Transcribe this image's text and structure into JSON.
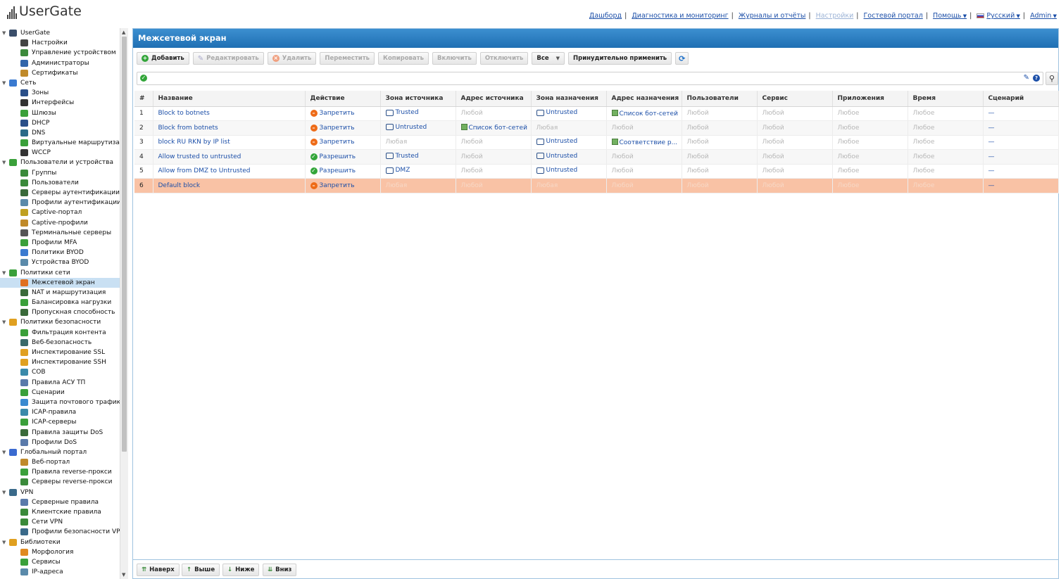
{
  "app": {
    "logo_text": "UserGate",
    "colors": {
      "accent": "#1f6fb3",
      "deny": "#ee6b17",
      "allow": "#32a539",
      "highlight": "#f9c2a5",
      "link": "#1c4fa8"
    }
  },
  "topnav": {
    "dashboard": "Дашборд",
    "diagnostics": "Диагностика и мониторинг",
    "logs": "Журналы и отчёты",
    "settings": "Настройки",
    "guest_portal": "Гостевой портал",
    "help": "Помощь",
    "language": "Русский",
    "user": "Admin"
  },
  "sidebar": {
    "items": [
      {
        "level": 0,
        "label": "UserGate",
        "icon": "gear-icon",
        "color": "#3a4e6a"
      },
      {
        "level": 1,
        "label": "Настройки",
        "icon": "settings-icon",
        "color": "#444"
      },
      {
        "level": 1,
        "label": "Управление устройством",
        "icon": "device-icon",
        "color": "#3c8a3c"
      },
      {
        "level": 1,
        "label": "Администраторы",
        "icon": "admins-icon",
        "color": "#3366aa"
      },
      {
        "level": 1,
        "label": "Сертификаты",
        "icon": "certificate-icon",
        "color": "#c08a2a"
      },
      {
        "level": 0,
        "label": "Сеть",
        "icon": "network-icon",
        "color": "#3a7ad0"
      },
      {
        "level": 1,
        "label": "Зоны",
        "icon": "zones-icon",
        "color": "#2a4f88"
      },
      {
        "level": 1,
        "label": "Интерфейсы",
        "icon": "interfaces-icon",
        "color": "#333"
      },
      {
        "level": 1,
        "label": "Шлюзы",
        "icon": "gateways-icon",
        "color": "#3aa03a"
      },
      {
        "level": 1,
        "label": "DHCP",
        "icon": "dhcp-icon",
        "color": "#2a4f88"
      },
      {
        "level": 1,
        "label": "DNS",
        "icon": "dns-icon",
        "color": "#2a6a88"
      },
      {
        "level": 1,
        "label": "Виртуальные маршрутизаторы",
        "icon": "router-icon",
        "color": "#3aa03a"
      },
      {
        "level": 1,
        "label": "WCCP",
        "icon": "wccp-icon",
        "color": "#333"
      },
      {
        "level": 0,
        "label": "Пользователи и устройства",
        "icon": "users-devices-icon",
        "color": "#3aa03a"
      },
      {
        "level": 1,
        "label": "Группы",
        "icon": "groups-icon",
        "color": "#3a8a3a"
      },
      {
        "level": 1,
        "label": "Пользователи",
        "icon": "users-icon",
        "color": "#3a8a3a"
      },
      {
        "level": 1,
        "label": "Серверы аутентификации",
        "icon": "auth-server-icon",
        "color": "#3a6a3a"
      },
      {
        "level": 1,
        "label": "Профили аутентификации",
        "icon": "auth-profile-icon",
        "color": "#5a8aaa"
      },
      {
        "level": 1,
        "label": "Captive-портал",
        "icon": "captive-portal-icon",
        "color": "#c0a020"
      },
      {
        "level": 1,
        "label": "Captive-профили",
        "icon": "captive-profile-icon",
        "color": "#c08a2a"
      },
      {
        "level": 1,
        "label": "Терминальные серверы",
        "icon": "terminal-server-icon",
        "color": "#555"
      },
      {
        "level": 1,
        "label": "Профили MFA",
        "icon": "mfa-icon",
        "color": "#3aa03a"
      },
      {
        "level": 1,
        "label": "Политики BYOD",
        "icon": "byod-policy-icon",
        "color": "#3a7ad0"
      },
      {
        "level": 1,
        "label": "Устройства BYOD",
        "icon": "byod-device-icon",
        "color": "#5a8aaa"
      },
      {
        "level": 0,
        "label": "Политики сети",
        "icon": "network-policy-icon",
        "color": "#3aa03a"
      },
      {
        "level": 1,
        "label": "Межсетевой экран",
        "icon": "firewall-icon",
        "color": "#e07020",
        "selected": true
      },
      {
        "level": 1,
        "label": "NAT и маршрутизация",
        "icon": "nat-icon",
        "color": "#3a6a3a"
      },
      {
        "level": 1,
        "label": "Балансировка нагрузки",
        "icon": "balancing-icon",
        "color": "#3aa03a"
      },
      {
        "level": 1,
        "label": "Пропускная способность",
        "icon": "bandwidth-icon",
        "color": "#3a6a3a"
      },
      {
        "level": 0,
        "label": "Политики безопасности",
        "icon": "security-policy-icon",
        "color": "#e0a020"
      },
      {
        "level": 1,
        "label": "Фильтрация контента",
        "icon": "content-filter-icon",
        "color": "#3aa03a"
      },
      {
        "level": 1,
        "label": "Веб-безопасность",
        "icon": "web-security-icon",
        "color": "#3a6a6a"
      },
      {
        "level": 1,
        "label": "Инспектирование SSL",
        "icon": "ssl-icon",
        "color": "#e0a020"
      },
      {
        "level": 1,
        "label": "Инспектирование SSH",
        "icon": "ssh-icon",
        "color": "#e0a020"
      },
      {
        "level": 1,
        "label": "СОВ",
        "icon": "ids-icon",
        "color": "#3a8aaa"
      },
      {
        "level": 1,
        "label": "Правила АСУ ТП",
        "icon": "scada-icon",
        "color": "#5a7aaa"
      },
      {
        "level": 1,
        "label": "Сценарии",
        "icon": "scenarios-icon",
        "color": "#3aa03a"
      },
      {
        "level": 1,
        "label": "Защита почтового трафика",
        "icon": "mail-security-icon",
        "color": "#3a8ad0"
      },
      {
        "level": 1,
        "label": "ICAP-правила",
        "icon": "icap-rules-icon",
        "color": "#3a8aaa"
      },
      {
        "level": 1,
        "label": "ICAP-серверы",
        "icon": "icap-servers-icon",
        "color": "#3aa03a"
      },
      {
        "level": 1,
        "label": "Правила защиты DoS",
        "icon": "dos-rules-icon",
        "color": "#3a6a3a"
      },
      {
        "level": 1,
        "label": "Профили DoS",
        "icon": "dos-profile-icon",
        "color": "#5a7aaa"
      },
      {
        "level": 0,
        "label": "Глобальный портал",
        "icon": "global-portal-icon",
        "color": "#3a6ad0"
      },
      {
        "level": 1,
        "label": "Веб-портал",
        "icon": "web-portal-icon",
        "color": "#c08a2a"
      },
      {
        "level": 1,
        "label": "Правила reverse-прокси",
        "icon": "reverse-proxy-rules-icon",
        "color": "#3aa03a"
      },
      {
        "level": 1,
        "label": "Серверы reverse-прокси",
        "icon": "reverse-proxy-servers-icon",
        "color": "#3a8a3a"
      },
      {
        "level": 0,
        "label": "VPN",
        "icon": "vpn-icon",
        "color": "#3a6a8a"
      },
      {
        "level": 1,
        "label": "Серверные правила",
        "icon": "vpn-server-rules-icon",
        "color": "#5a7aaa"
      },
      {
        "level": 1,
        "label": "Клиентские правила",
        "icon": "vpn-client-rules-icon",
        "color": "#3a8a3a"
      },
      {
        "level": 1,
        "label": "Сети VPN",
        "icon": "vpn-networks-icon",
        "color": "#3a8a3a"
      },
      {
        "level": 1,
        "label": "Профили безопасности VPN",
        "icon": "vpn-security-profile-icon",
        "color": "#3a6a8a"
      },
      {
        "level": 0,
        "label": "Библиотеки",
        "icon": "libraries-icon",
        "color": "#e0a020"
      },
      {
        "level": 1,
        "label": "Морфология",
        "icon": "morphology-icon",
        "color": "#e08a20"
      },
      {
        "level": 1,
        "label": "Сервисы",
        "icon": "services-icon",
        "color": "#3aa03a"
      },
      {
        "level": 1,
        "label": "IP-адреса",
        "icon": "ip-addresses-icon",
        "color": "#5a8aaa"
      }
    ]
  },
  "panel": {
    "title": "Межсетевой экран",
    "toolbar": {
      "add": "Добавить",
      "edit": "Редактировать",
      "delete": "Удалить",
      "move": "Переместить",
      "copy": "Копировать",
      "enable": "Включить",
      "disable": "Отключить",
      "filter": "Все",
      "force_apply": "Принудительно применить"
    },
    "search": {
      "value": "",
      "placeholder": ""
    },
    "columns": [
      "#",
      "Название",
      "Действие",
      "Зона источника",
      "Адрес источника",
      "Зона назначения",
      "Адрес назначения",
      "Пользователи",
      "Сервис",
      "Приложения",
      "Время",
      "Сценарий"
    ],
    "rows": [
      {
        "num": "1",
        "name": "Block to botnets",
        "action": "Запретить",
        "action_type": "deny",
        "src_zone": "Trusted",
        "src_addr": "Любой",
        "dst_zone": "Untrusted",
        "dst_addr": "Список бот-сетей",
        "users": "Любой",
        "service": "Любой",
        "apps": "Любое",
        "time": "Любое",
        "scenario": "—"
      },
      {
        "num": "2",
        "name": "Block from botnets",
        "action": "Запретить",
        "action_type": "deny",
        "src_zone": "Untrusted",
        "src_addr": "Список бот-сетей",
        "dst_zone": "Любая",
        "dst_addr": "Любой",
        "users": "Любой",
        "service": "Любой",
        "apps": "Любое",
        "time": "Любое",
        "scenario": "—"
      },
      {
        "num": "3",
        "name": "block RU RKN by IP list",
        "action": "Запретить",
        "action_type": "deny",
        "src_zone": "Любая",
        "src_addr": "Любой",
        "dst_zone": "Untrusted",
        "dst_addr": "Соответствие р...",
        "users": "Любой",
        "service": "Любой",
        "apps": "Любое",
        "time": "Любое",
        "scenario": "—"
      },
      {
        "num": "4",
        "name": "Allow trusted to untrusted",
        "action": "Разрешить",
        "action_type": "allow",
        "src_zone": "Trusted",
        "src_addr": "Любой",
        "dst_zone": "Untrusted",
        "dst_addr": "Любой",
        "users": "Любой",
        "service": "Любой",
        "apps": "Любое",
        "time": "Любое",
        "scenario": "—"
      },
      {
        "num": "5",
        "name": "Allow from DMZ to Untrusted",
        "action": "Разрешить",
        "action_type": "allow",
        "src_zone": "DMZ",
        "src_addr": "Любой",
        "dst_zone": "Untrusted",
        "dst_addr": "Любой",
        "users": "Любой",
        "service": "Любой",
        "apps": "Любое",
        "time": "Любое",
        "scenario": "—"
      },
      {
        "num": "6",
        "name": "Default block",
        "action": "Запретить",
        "action_type": "deny",
        "src_zone": "Любая",
        "src_addr": "Любой",
        "dst_zone": "Любая",
        "dst_addr": "Любой",
        "users": "Любой",
        "service": "Любой",
        "apps": "Любое",
        "time": "Любое",
        "scenario": "—",
        "highlighted": true
      }
    ]
  },
  "bottombar": {
    "top": "Наверх",
    "up": "Выше",
    "down": "Ниже",
    "bottom": "Вниз"
  }
}
